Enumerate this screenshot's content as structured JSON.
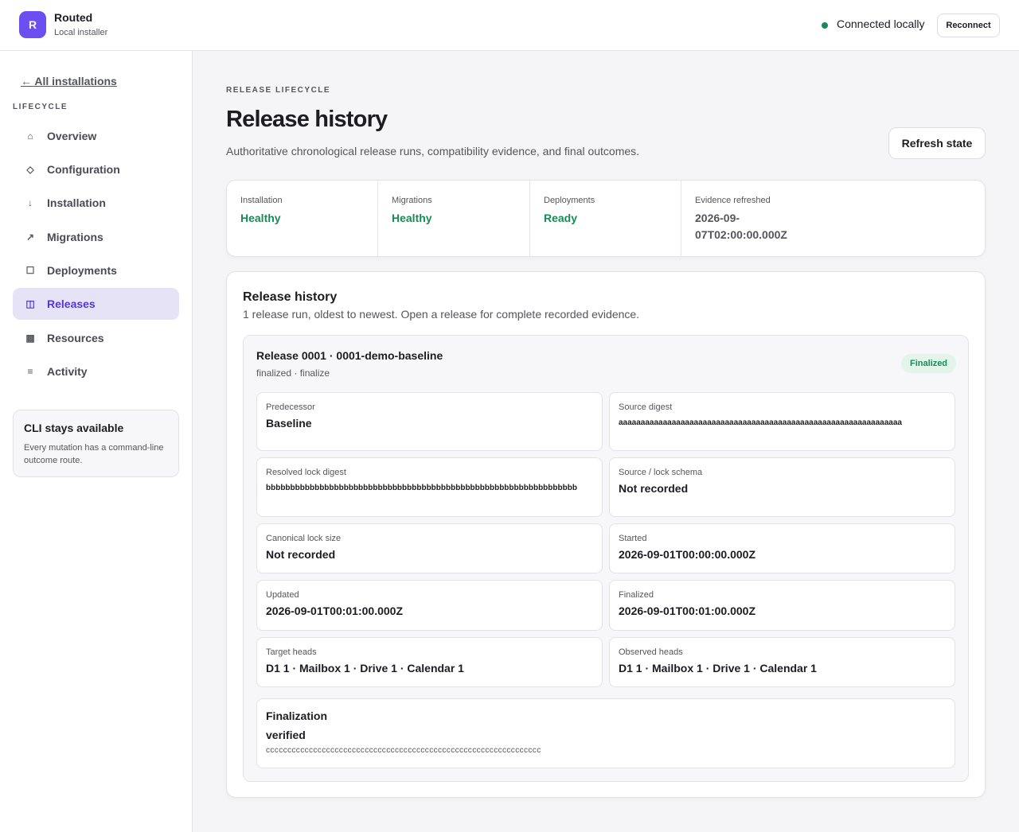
{
  "header": {
    "logo_letter": "R",
    "app_name": "Routed",
    "app_sub": "Local installer",
    "status_text": "Connected locally",
    "reconnect_label": "Reconnect",
    "status_color": "#1a8a55",
    "accent_color": "#6d4ef0"
  },
  "sidebar": {
    "back_link": "← All installations",
    "section_label": "LIFECYCLE",
    "items": [
      {
        "label": "Overview",
        "icon": "⌂",
        "icon_name": "home-icon"
      },
      {
        "label": "Configuration",
        "icon": "◇",
        "icon_name": "diamond-icon"
      },
      {
        "label": "Installation",
        "icon": "↓",
        "icon_name": "arrow-down-icon"
      },
      {
        "label": "Migrations",
        "icon": "↗",
        "icon_name": "arrow-up-right-icon"
      },
      {
        "label": "Deployments",
        "icon": "☐",
        "icon_name": "square-icon"
      },
      {
        "label": "Releases",
        "icon": "◫",
        "icon_name": "columns-icon",
        "active": true
      },
      {
        "label": "Resources",
        "icon": "▦",
        "icon_name": "grid-icon"
      },
      {
        "label": "Activity",
        "icon": "≡",
        "icon_name": "list-icon"
      }
    ],
    "cli_title": "CLI stays available",
    "cli_text": "Every mutation has a command-line outcome route."
  },
  "page": {
    "eyebrow": "RELEASE LIFECYCLE",
    "title": "Release history",
    "description": "Authoritative chronological release runs, compatibility evidence, and final outcomes.",
    "refresh_label": "Refresh state"
  },
  "summary": [
    {
      "label": "Installation",
      "value": "Healthy"
    },
    {
      "label": "Migrations",
      "value": "Healthy"
    },
    {
      "label": "Deployments",
      "value": "Ready"
    },
    {
      "label": "Evidence refreshed",
      "value": "2026-09-07T02:00:00.000Z"
    }
  ],
  "history": {
    "title": "Release history",
    "subtitle": "1 release run, oldest to newest. Open a release for complete recorded evidence."
  },
  "release": {
    "title": "Release 0001 · 0001-demo-baseline",
    "meta": "finalized · finalize",
    "badge": "Finalized",
    "fields": [
      {
        "label": "Predecessor",
        "value": "Baseline"
      },
      {
        "label": "Source digest",
        "value": "aaaaaaaaaaaaaaaaaaaaaaaaaaaaaaaaaaaaaaaaaaaaaaaaaaaaaaaaaaaaaaaa"
      },
      {
        "label": "Resolved lock digest",
        "value": "bbbbbbbbbbbbbbbbbbbbbbbbbbbbbbbbbbbbbbbbbbbbbbbbbbbbbbbbbbbbbbbb"
      },
      {
        "label": "Source / lock schema",
        "value": "Not recorded"
      },
      {
        "label": "Canonical lock size",
        "value": "Not recorded"
      },
      {
        "label": "Started",
        "value": "2026-09-01T00:00:00.000Z"
      },
      {
        "label": "Updated",
        "value": "2026-09-01T00:01:00.000Z"
      },
      {
        "label": "Finalized",
        "value": "2026-09-01T00:01:00.000Z"
      },
      {
        "label": "Target heads",
        "value": "D1 1 · Mailbox 1 · Drive 1 · Calendar 1"
      },
      {
        "label": "Observed heads",
        "value": "D1 1 · Mailbox 1 · Drive 1 · Calendar 1"
      }
    ],
    "finalization": {
      "title": "Finalization",
      "value": "verified",
      "digest": "cccccccccccccccccccccccccccccccccccccccccccccccccccccccccccccccc"
    }
  }
}
